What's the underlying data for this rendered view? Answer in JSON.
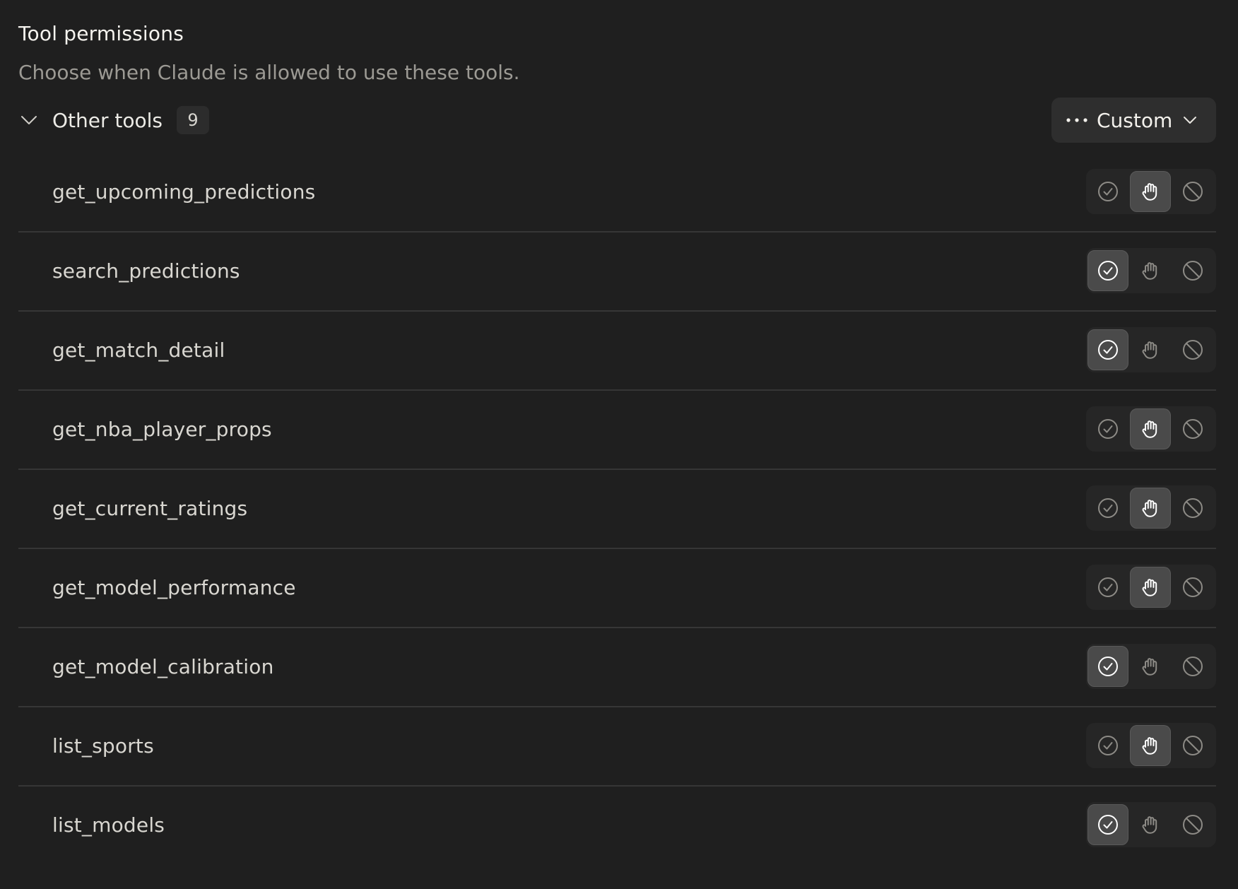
{
  "header": {
    "title": "Tool permissions",
    "subtitle": "Choose when Claude is allowed to use these tools."
  },
  "group": {
    "title": "Other tools",
    "count": "9",
    "expanded": true,
    "dropdown": {
      "label": "Custom",
      "icon": "more-horizontal-icon"
    }
  },
  "permission_options": [
    "always-allow",
    "needs-approval",
    "blocked"
  ],
  "option_icons": {
    "always-allow": "check-circle-icon",
    "needs-approval": "hand-icon",
    "blocked": "ban-icon"
  },
  "tools": [
    {
      "name": "get_upcoming_predictions",
      "permission": "needs-approval"
    },
    {
      "name": "search_predictions",
      "permission": "always-allow"
    },
    {
      "name": "get_match_detail",
      "permission": "always-allow"
    },
    {
      "name": "get_nba_player_props",
      "permission": "needs-approval"
    },
    {
      "name": "get_current_ratings",
      "permission": "needs-approval"
    },
    {
      "name": "get_model_performance",
      "permission": "needs-approval"
    },
    {
      "name": "get_model_calibration",
      "permission": "always-allow"
    },
    {
      "name": "list_sports",
      "permission": "needs-approval"
    },
    {
      "name": "list_models",
      "permission": "always-allow"
    }
  ],
  "colors": {
    "background": "#1f1f1f",
    "segment_bg": "#262626",
    "active_bg": "#4a4a4a",
    "divider": "#363636",
    "muted_text": "#9c9a94"
  }
}
